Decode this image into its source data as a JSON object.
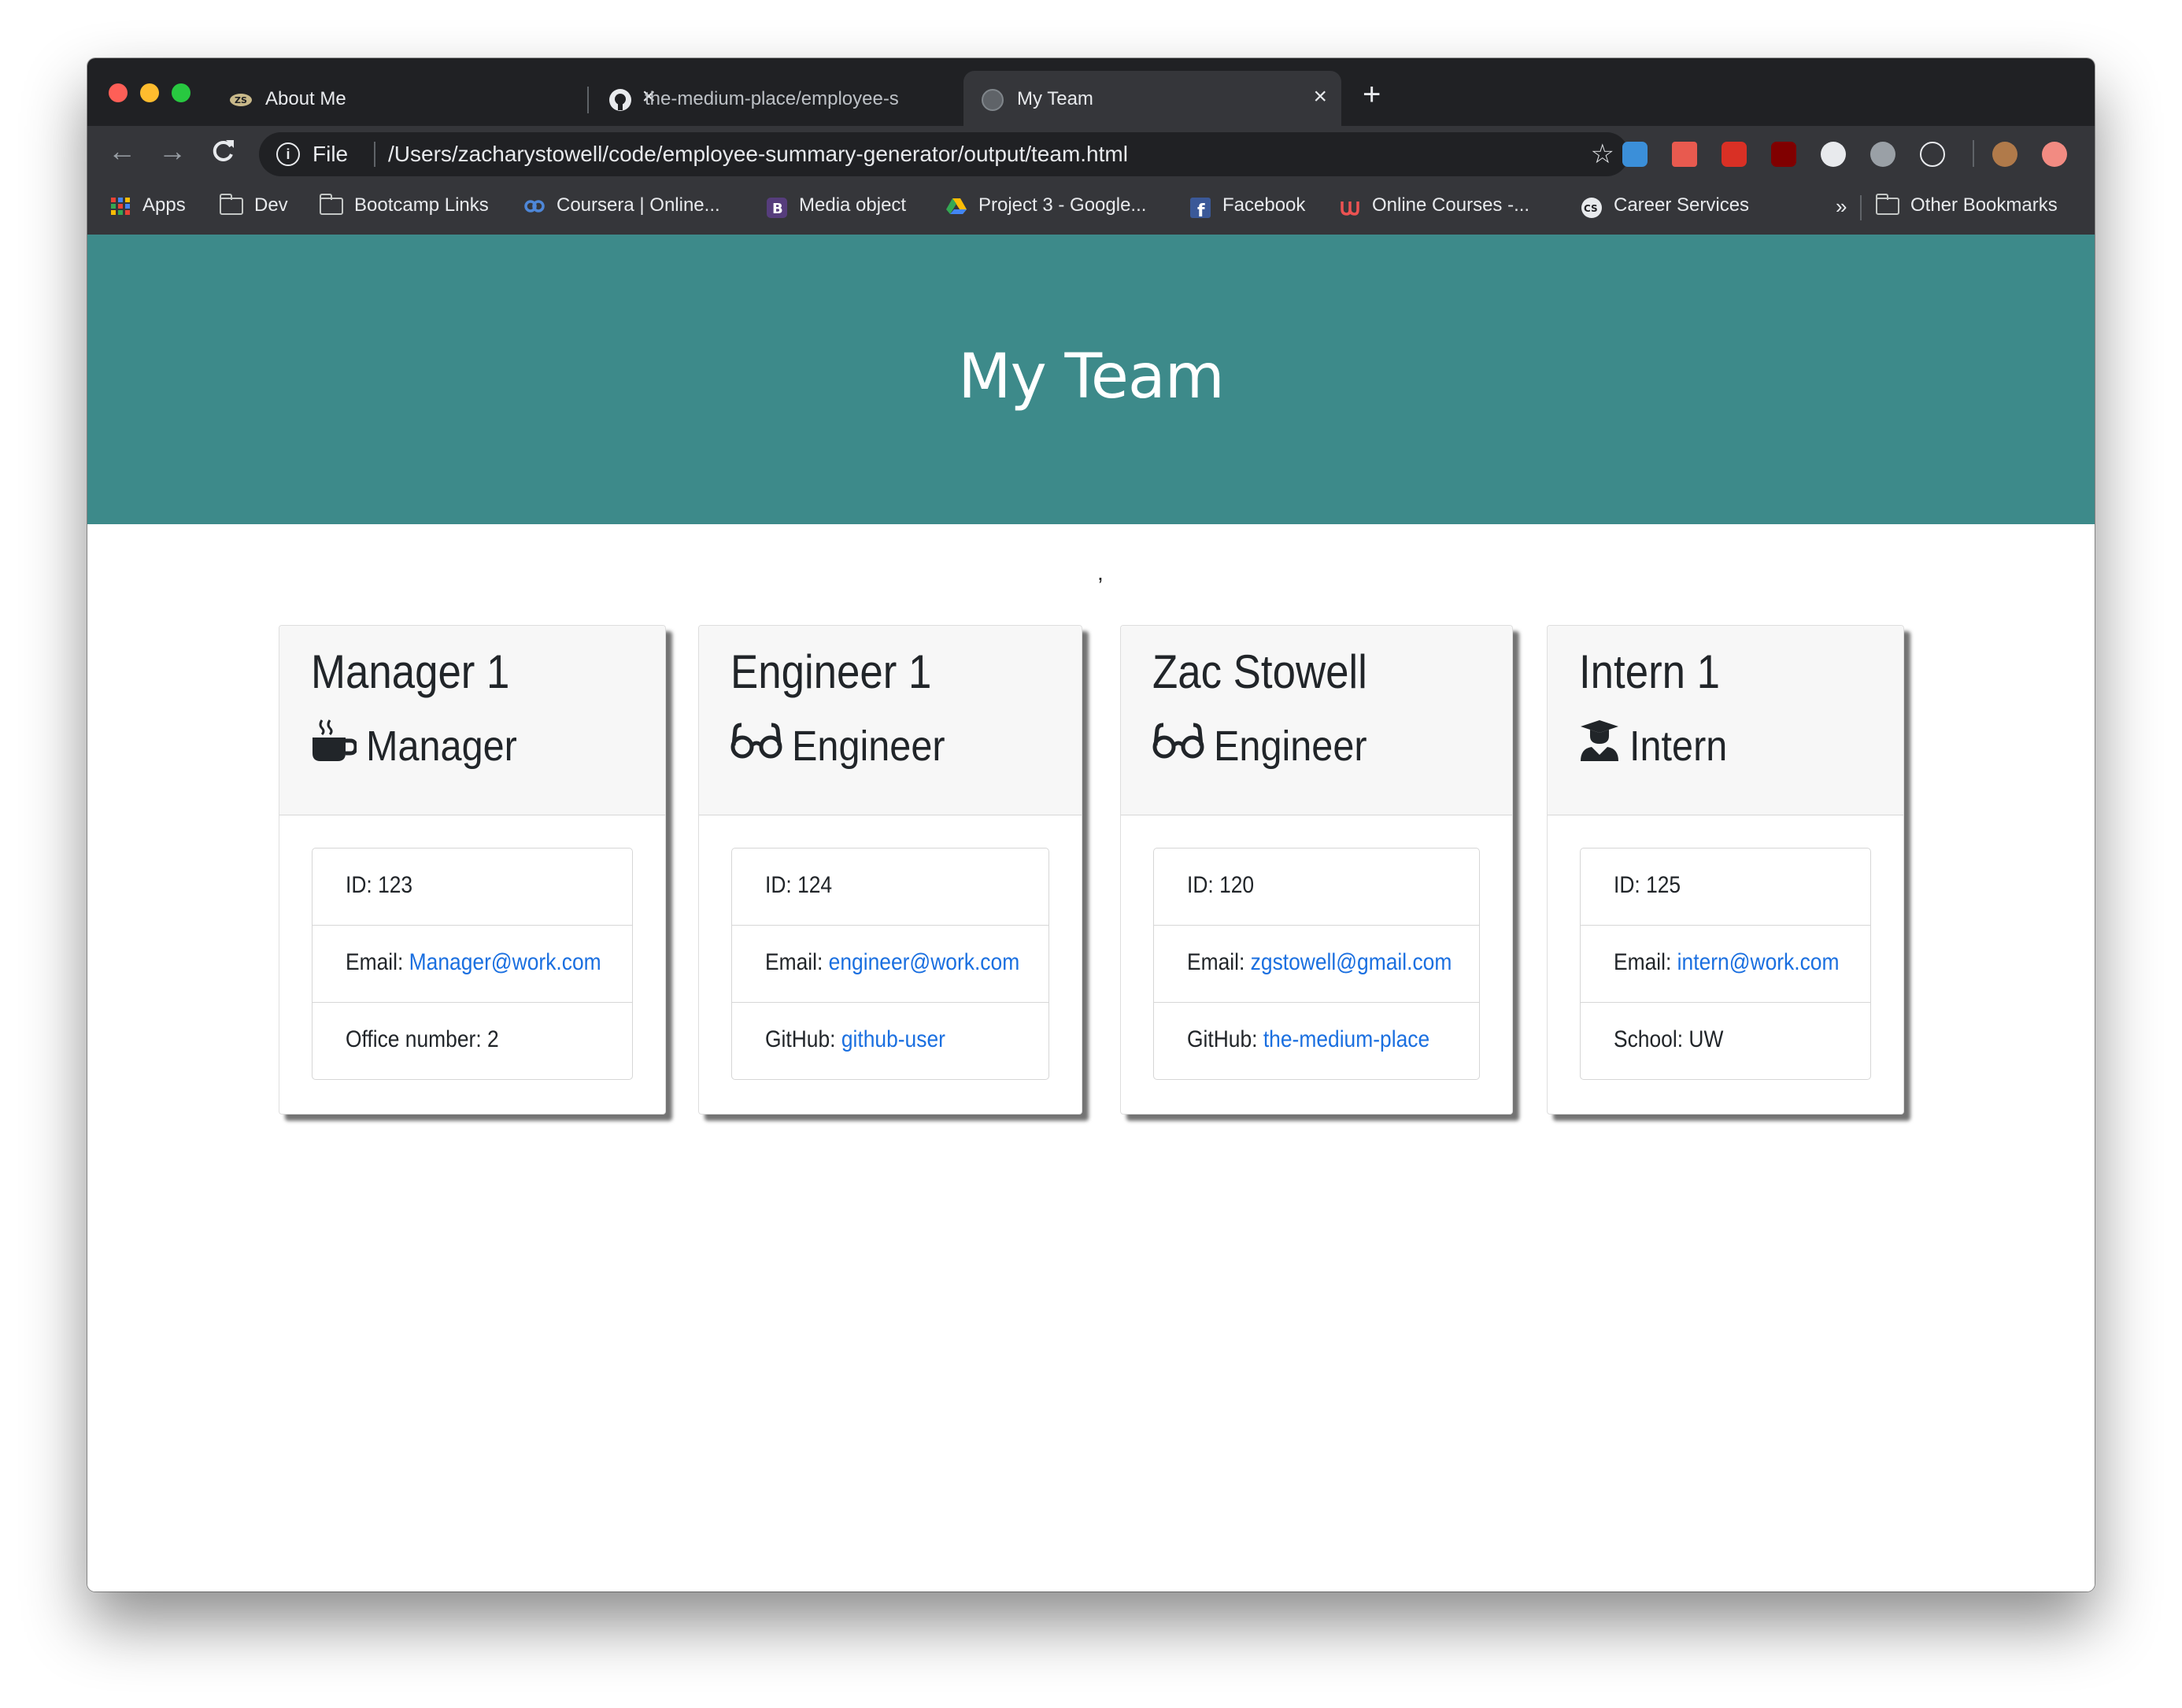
{
  "browser": {
    "tabs": [
      {
        "title": "About Me",
        "favicon": "zs-logo-icon",
        "active": false
      },
      {
        "title": "the-medium-place/employee-s",
        "favicon": "github-icon",
        "active": false
      },
      {
        "title": "My Team",
        "favicon": "globe-icon",
        "active": true
      }
    ],
    "new_tab": "+",
    "address": {
      "scheme": "File",
      "url": "/Users/zacharystowell/code/employee-summary-generator/output/team.html"
    },
    "bookmarks": [
      {
        "label": "Apps",
        "icon": "apps-grid-icon"
      },
      {
        "label": "Dev",
        "icon": "folder-icon"
      },
      {
        "label": "Bootcamp Links",
        "icon": "folder-icon"
      },
      {
        "label": "Coursera | Online...",
        "icon": "coursera-icon"
      },
      {
        "label": "Media object",
        "icon": "bootstrap-icon"
      },
      {
        "label": "Project 3 - Google...",
        "icon": "google-drive-icon"
      },
      {
        "label": "Facebook",
        "icon": "facebook-icon"
      },
      {
        "label": "Online Courses -...",
        "icon": "udemy-icon"
      },
      {
        "label": "Career Services",
        "icon": "cs-icon"
      }
    ],
    "overflow": "»",
    "other_bookmarks": "Other Bookmarks"
  },
  "page": {
    "title": "My Team",
    "stray_text": ",",
    "cards": [
      {
        "name": "Manager 1",
        "role": "Manager",
        "role_icon": "coffee-mug-icon",
        "id_text": "ID: 123",
        "email_label": "Email: ",
        "email": "Manager@work.com",
        "extra_label": "Office number: 2",
        "extra_link": ""
      },
      {
        "name": "Engineer 1",
        "role": "Engineer",
        "role_icon": "glasses-icon",
        "id_text": "ID: 124",
        "email_label": "Email: ",
        "email": "engineer@work.com",
        "extra_label": "GitHub: ",
        "extra_link": "github-user"
      },
      {
        "name": "Zac Stowell",
        "role": "Engineer",
        "role_icon": "glasses-icon",
        "id_text": "ID: 120",
        "email_label": "Email: ",
        "email": "zgstowell@gmail.com",
        "extra_label": "GitHub: ",
        "extra_link": "the-medium-place"
      },
      {
        "name": "Intern 1",
        "role": "Intern",
        "role_icon": "graduate-icon",
        "id_text": "ID: 125",
        "email_label": "Email: ",
        "email": "intern@work.com",
        "extra_label": "School: UW",
        "extra_link": ""
      }
    ]
  }
}
